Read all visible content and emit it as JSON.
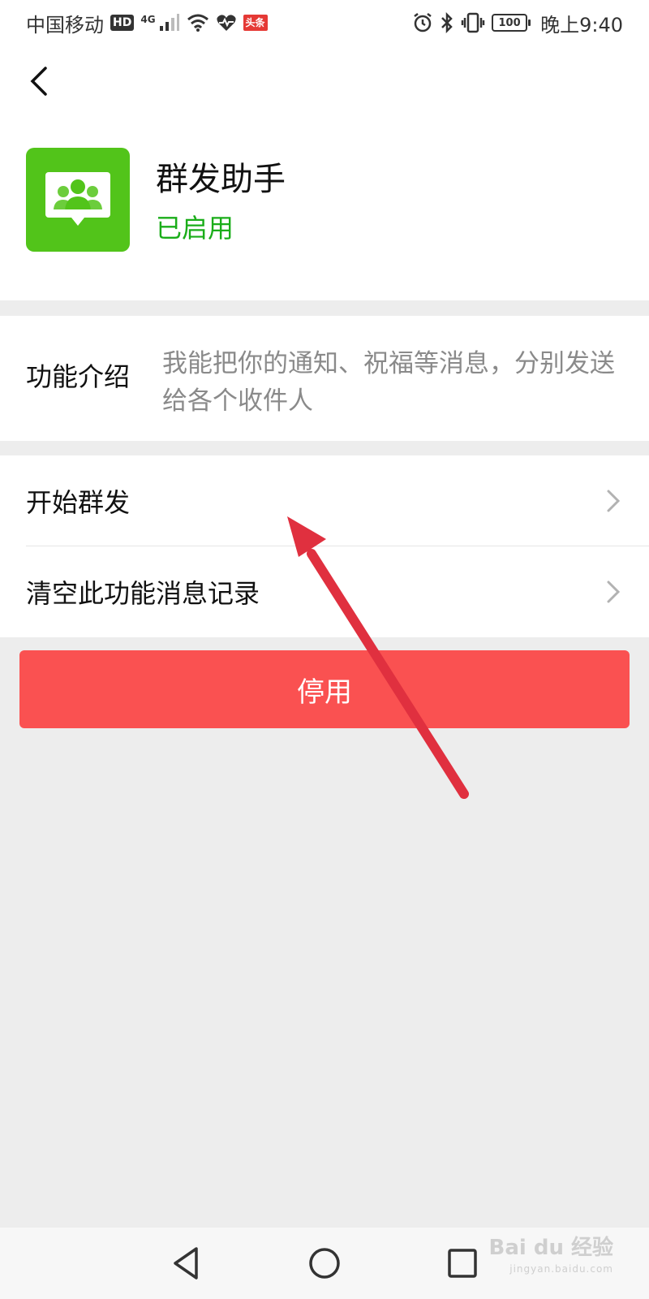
{
  "status_bar": {
    "carrier": "中国移动",
    "hd_badge": "HD",
    "network": "4G",
    "news_badge": "头条",
    "battery_level": "100",
    "time": "晚上9:40"
  },
  "header": {
    "back_icon": "chevron-left-icon"
  },
  "app": {
    "name": "群发助手",
    "status": "已启用",
    "icon": "group-chat-icon",
    "icon_color": "#52c41a",
    "status_color": "#1aad19"
  },
  "intro": {
    "label": "功能介绍",
    "text": "我能把你的通知、祝福等消息，分别发送给各个收件人"
  },
  "menu": {
    "items": [
      {
        "label": "开始群发",
        "icon": "chevron-right-icon"
      },
      {
        "label": "清空此功能消息记录",
        "icon": "chevron-right-icon"
      }
    ]
  },
  "disable_button": {
    "label": "停用",
    "color": "#fa5151"
  },
  "annotation": {
    "type": "arrow",
    "color": "#e0303f"
  },
  "nav_bar": {
    "back_icon": "triangle-back-icon",
    "home_icon": "circle-home-icon",
    "recent_icon": "square-recent-icon"
  },
  "watermark": {
    "text": "Bai du 经验",
    "sub": "jingyan.baidu.com"
  }
}
